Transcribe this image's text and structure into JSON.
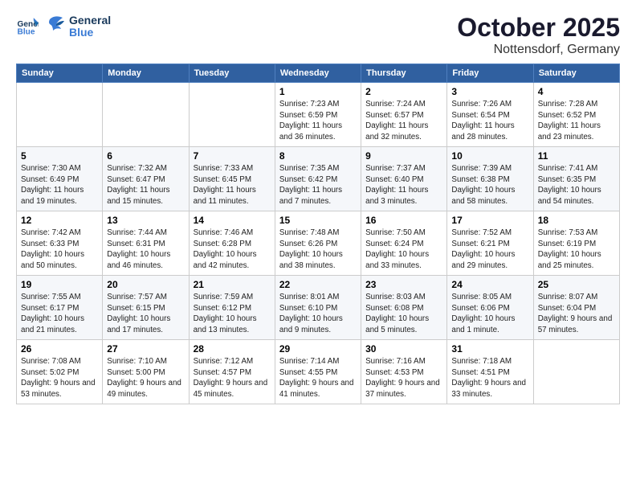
{
  "logo": {
    "line1": "General",
    "line2": "Blue"
  },
  "title": "October 2025",
  "subtitle": "Nottensdorf, Germany",
  "days_header": [
    "Sunday",
    "Monday",
    "Tuesday",
    "Wednesday",
    "Thursday",
    "Friday",
    "Saturday"
  ],
  "weeks": [
    [
      {
        "num": "",
        "text": ""
      },
      {
        "num": "",
        "text": ""
      },
      {
        "num": "",
        "text": ""
      },
      {
        "num": "1",
        "text": "Sunrise: 7:23 AM\nSunset: 6:59 PM\nDaylight: 11 hours and 36 minutes."
      },
      {
        "num": "2",
        "text": "Sunrise: 7:24 AM\nSunset: 6:57 PM\nDaylight: 11 hours and 32 minutes."
      },
      {
        "num": "3",
        "text": "Sunrise: 7:26 AM\nSunset: 6:54 PM\nDaylight: 11 hours and 28 minutes."
      },
      {
        "num": "4",
        "text": "Sunrise: 7:28 AM\nSunset: 6:52 PM\nDaylight: 11 hours and 23 minutes."
      }
    ],
    [
      {
        "num": "5",
        "text": "Sunrise: 7:30 AM\nSunset: 6:49 PM\nDaylight: 11 hours and 19 minutes."
      },
      {
        "num": "6",
        "text": "Sunrise: 7:32 AM\nSunset: 6:47 PM\nDaylight: 11 hours and 15 minutes."
      },
      {
        "num": "7",
        "text": "Sunrise: 7:33 AM\nSunset: 6:45 PM\nDaylight: 11 hours and 11 minutes."
      },
      {
        "num": "8",
        "text": "Sunrise: 7:35 AM\nSunset: 6:42 PM\nDaylight: 11 hours and 7 minutes."
      },
      {
        "num": "9",
        "text": "Sunrise: 7:37 AM\nSunset: 6:40 PM\nDaylight: 11 hours and 3 minutes."
      },
      {
        "num": "10",
        "text": "Sunrise: 7:39 AM\nSunset: 6:38 PM\nDaylight: 10 hours and 58 minutes."
      },
      {
        "num": "11",
        "text": "Sunrise: 7:41 AM\nSunset: 6:35 PM\nDaylight: 10 hours and 54 minutes."
      }
    ],
    [
      {
        "num": "12",
        "text": "Sunrise: 7:42 AM\nSunset: 6:33 PM\nDaylight: 10 hours and 50 minutes."
      },
      {
        "num": "13",
        "text": "Sunrise: 7:44 AM\nSunset: 6:31 PM\nDaylight: 10 hours and 46 minutes."
      },
      {
        "num": "14",
        "text": "Sunrise: 7:46 AM\nSunset: 6:28 PM\nDaylight: 10 hours and 42 minutes."
      },
      {
        "num": "15",
        "text": "Sunrise: 7:48 AM\nSunset: 6:26 PM\nDaylight: 10 hours and 38 minutes."
      },
      {
        "num": "16",
        "text": "Sunrise: 7:50 AM\nSunset: 6:24 PM\nDaylight: 10 hours and 33 minutes."
      },
      {
        "num": "17",
        "text": "Sunrise: 7:52 AM\nSunset: 6:21 PM\nDaylight: 10 hours and 29 minutes."
      },
      {
        "num": "18",
        "text": "Sunrise: 7:53 AM\nSunset: 6:19 PM\nDaylight: 10 hours and 25 minutes."
      }
    ],
    [
      {
        "num": "19",
        "text": "Sunrise: 7:55 AM\nSunset: 6:17 PM\nDaylight: 10 hours and 21 minutes."
      },
      {
        "num": "20",
        "text": "Sunrise: 7:57 AM\nSunset: 6:15 PM\nDaylight: 10 hours and 17 minutes."
      },
      {
        "num": "21",
        "text": "Sunrise: 7:59 AM\nSunset: 6:12 PM\nDaylight: 10 hours and 13 minutes."
      },
      {
        "num": "22",
        "text": "Sunrise: 8:01 AM\nSunset: 6:10 PM\nDaylight: 10 hours and 9 minutes."
      },
      {
        "num": "23",
        "text": "Sunrise: 8:03 AM\nSunset: 6:08 PM\nDaylight: 10 hours and 5 minutes."
      },
      {
        "num": "24",
        "text": "Sunrise: 8:05 AM\nSunset: 6:06 PM\nDaylight: 10 hours and 1 minute."
      },
      {
        "num": "25",
        "text": "Sunrise: 8:07 AM\nSunset: 6:04 PM\nDaylight: 9 hours and 57 minutes."
      }
    ],
    [
      {
        "num": "26",
        "text": "Sunrise: 7:08 AM\nSunset: 5:02 PM\nDaylight: 9 hours and 53 minutes."
      },
      {
        "num": "27",
        "text": "Sunrise: 7:10 AM\nSunset: 5:00 PM\nDaylight: 9 hours and 49 minutes."
      },
      {
        "num": "28",
        "text": "Sunrise: 7:12 AM\nSunset: 4:57 PM\nDaylight: 9 hours and 45 minutes."
      },
      {
        "num": "29",
        "text": "Sunrise: 7:14 AM\nSunset: 4:55 PM\nDaylight: 9 hours and 41 minutes."
      },
      {
        "num": "30",
        "text": "Sunrise: 7:16 AM\nSunset: 4:53 PM\nDaylight: 9 hours and 37 minutes."
      },
      {
        "num": "31",
        "text": "Sunrise: 7:18 AM\nSunset: 4:51 PM\nDaylight: 9 hours and 33 minutes."
      },
      {
        "num": "",
        "text": ""
      }
    ]
  ]
}
